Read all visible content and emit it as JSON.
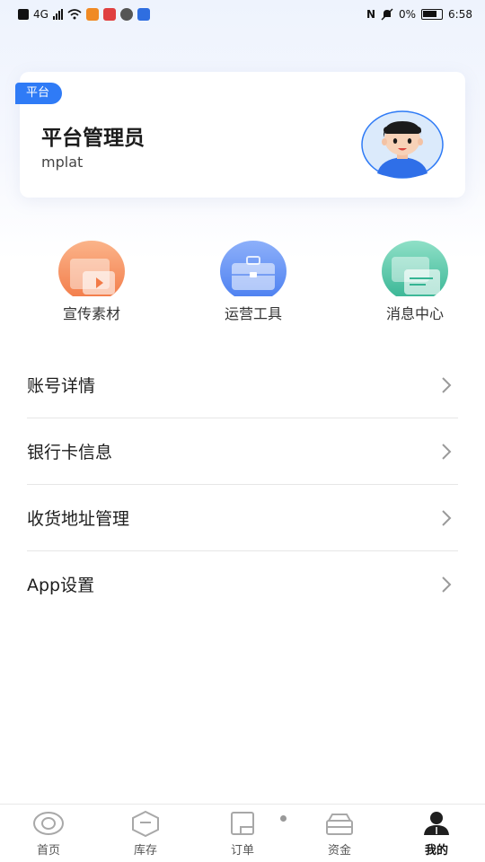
{
  "status_bar": {
    "left_text": "4G",
    "battery_text": "0%",
    "time": "6:58"
  },
  "profile": {
    "badge": "平台",
    "name": "平台管理员",
    "username": "mplat"
  },
  "shortcuts": [
    {
      "label": "宣传素材",
      "icon": "promo-material-icon",
      "color": "#f6905c"
    },
    {
      "label": "运营工具",
      "icon": "toolbox-icon",
      "color": "#5a8cf4"
    },
    {
      "label": "消息中心",
      "icon": "message-icon",
      "color": "#49c2a4"
    }
  ],
  "menu": [
    {
      "label": "账号详情"
    },
    {
      "label": "银行卡信息"
    },
    {
      "label": "收货地址管理"
    },
    {
      "label": "App设置"
    }
  ],
  "tabs": [
    {
      "label": "首页",
      "icon": "home-icon",
      "active": false
    },
    {
      "label": "库存",
      "icon": "inventory-icon",
      "active": false
    },
    {
      "label": "订单",
      "icon": "order-icon",
      "active": false
    },
    {
      "label": "资金",
      "icon": "wallet-icon",
      "active": false
    },
    {
      "label": "我的",
      "icon": "profile-icon",
      "active": true
    }
  ],
  "colors": {
    "accent": "#2f7bf6",
    "divider": "#e6e6e6"
  }
}
